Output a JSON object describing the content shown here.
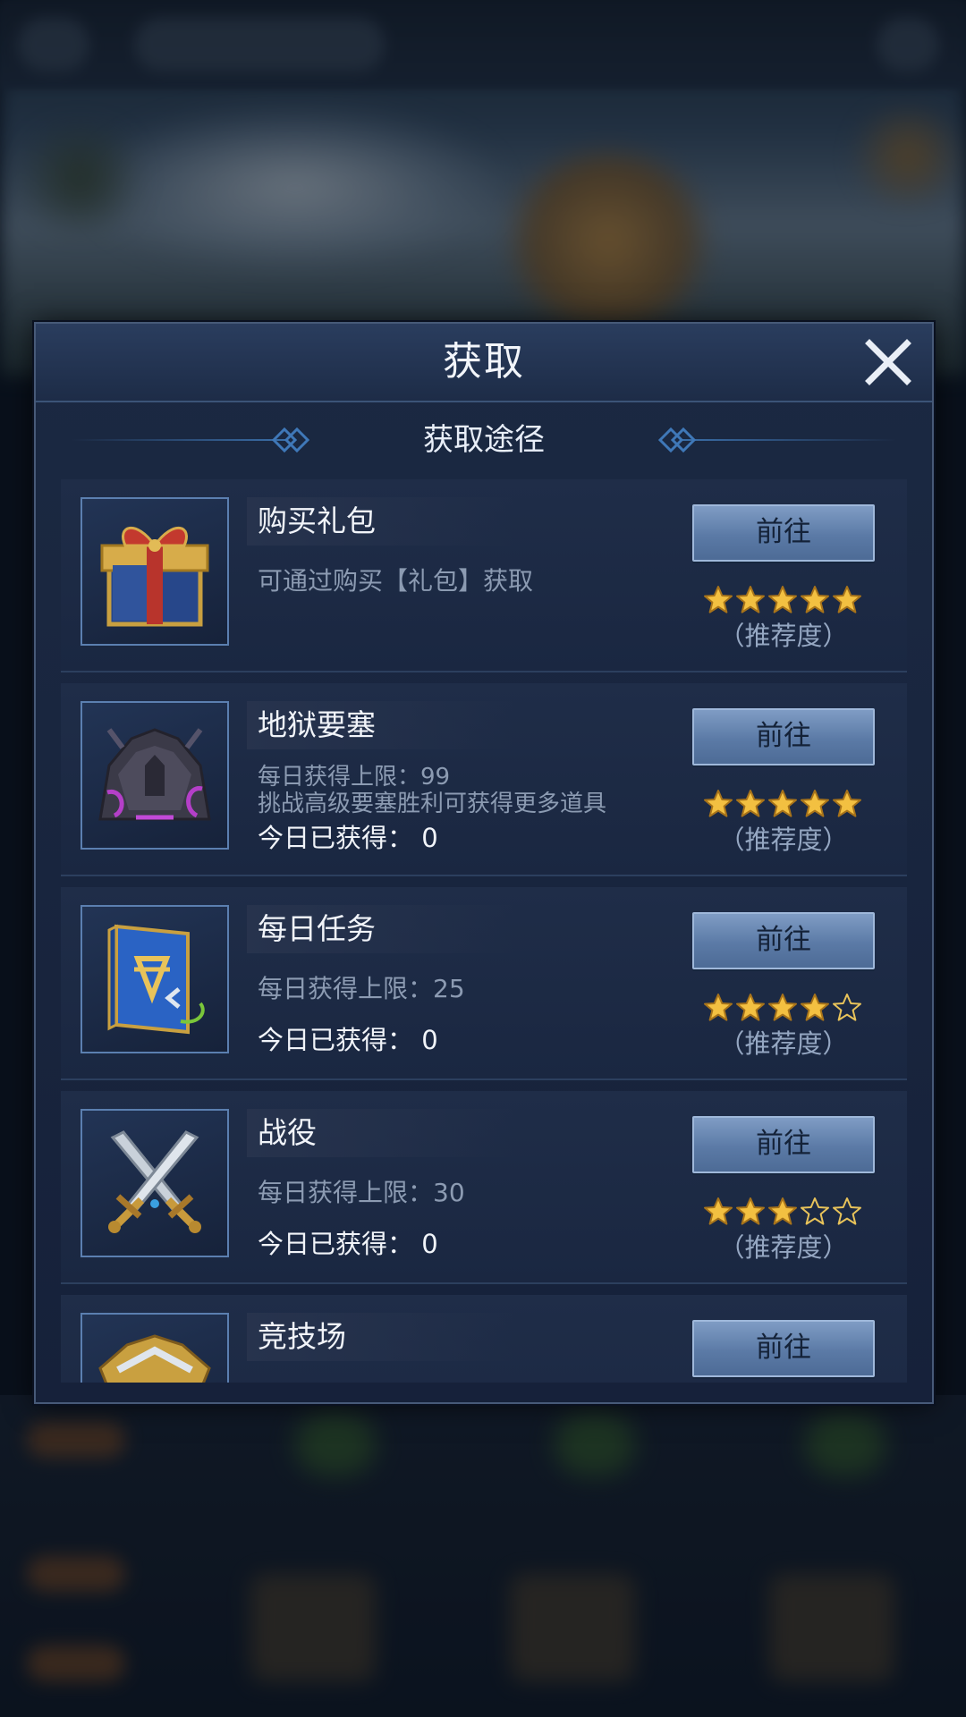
{
  "dialog": {
    "title": "获取",
    "section_title": "获取途径"
  },
  "items": [
    {
      "name": "购买礼包",
      "desc1": "可通过购买【礼包】获取",
      "desc2": "",
      "today": "",
      "button": "前往",
      "rating": 5,
      "recommend": "（推荐度）",
      "icon": "gift-box-icon"
    },
    {
      "name": "地狱要塞",
      "desc1": "每日获得上限：99",
      "desc2": "挑战高级要塞胜利可获得更多道具",
      "today": "今日已获得： 0",
      "button": "前往",
      "rating": 5,
      "recommend": "（推荐度）",
      "icon": "hell-fortress-icon"
    },
    {
      "name": "每日任务",
      "desc1": "每日获得上限：25",
      "desc2": "",
      "today": "今日已获得： 0",
      "button": "前往",
      "rating": 4,
      "recommend": "（推荐度）",
      "icon": "quest-book-icon"
    },
    {
      "name": "战役",
      "desc1": "每日获得上限：30",
      "desc2": "",
      "today": "今日已获得： 0",
      "button": "前往",
      "rating": 3,
      "recommend": "（推荐度）",
      "icon": "crossed-swords-icon"
    },
    {
      "name": "竞技场",
      "desc1": "",
      "desc2": "",
      "today": "",
      "button": "前往",
      "rating": 0,
      "recommend": "",
      "icon": "arena-emblem-icon"
    }
  ],
  "colors": {
    "star_gold": "#f3c041",
    "button_blue": "#6887b3",
    "panel": "#1b2942"
  }
}
